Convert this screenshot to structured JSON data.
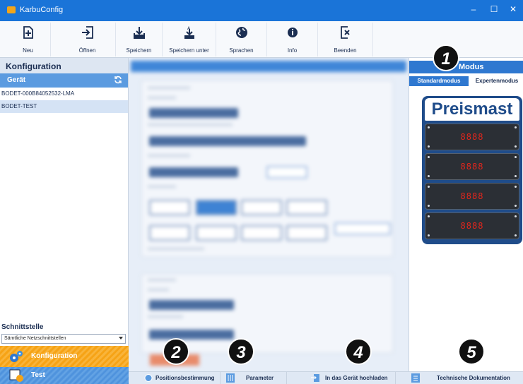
{
  "window": {
    "title": "KarbuConfig",
    "min_glyph": "–",
    "max_glyph": "☐",
    "close_glyph": "✕"
  },
  "toolbar": {
    "items": [
      {
        "label": "Neu",
        "icon": "new-file-icon"
      },
      {
        "label": "Öffnen",
        "icon": "open-icon"
      },
      {
        "label": "Speichern",
        "icon": "save-icon"
      },
      {
        "label": "Speichern unter",
        "icon": "save-as-icon"
      },
      {
        "label": "Sprachen",
        "icon": "globe-icon"
      },
      {
        "label": "Info",
        "icon": "info-icon"
      },
      {
        "label": "Beenden",
        "icon": "exit-icon"
      }
    ]
  },
  "sidebar": {
    "title": "Konfiguration",
    "device_header": "Gerät",
    "devices": [
      {
        "label": "BODET-000B84052532-LMA",
        "selected": false
      },
      {
        "label": "BODET-TEST",
        "selected": true
      }
    ],
    "interface_header": "Schnittstelle",
    "interface_value": "Sämtliche Netzschnittstellen",
    "nav": [
      {
        "label": "Konfiguration",
        "active": true
      },
      {
        "label": "Test",
        "active": false
      }
    ]
  },
  "bottombar": {
    "position": "Positionsbestimmung",
    "parameter": "Parameter",
    "upload": "In das Gerät hochladen",
    "docs": "Technische Dokumentation"
  },
  "rightpanel": {
    "title": "Modus",
    "tabs": [
      "Standardmodus",
      "Expertenmodus"
    ],
    "active_tab": "Standardmodus",
    "preview_title": "Preismast",
    "displays": [
      "8888",
      "8888",
      "8888",
      "8888"
    ]
  },
  "badges": [
    "1",
    "2",
    "3",
    "4",
    "5"
  ],
  "colors": {
    "titlebar": "#1a74d8",
    "accent": "#2f78d0",
    "active_nav": "#f6a316",
    "led": "#e0261d",
    "preis_frame": "#1f4c8a"
  }
}
